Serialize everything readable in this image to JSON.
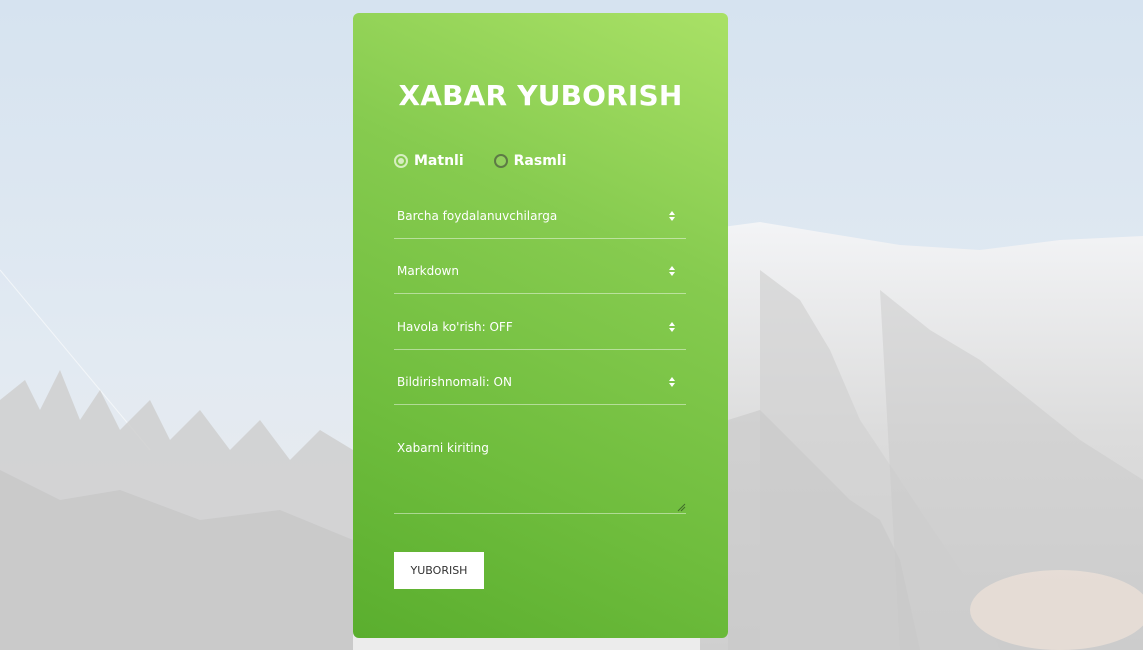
{
  "form": {
    "title": "XABAR YUBORISH",
    "message_type": {
      "options": [
        {
          "label": "Matnli",
          "checked": true
        },
        {
          "label": "Rasmli",
          "checked": false
        }
      ]
    },
    "selects": {
      "audience": "Barcha foydalanuvchilarga",
      "parse_mode": "Markdown",
      "link_preview": "Havola ko'rish: OFF",
      "notifications": "Bildirishnomali: ON"
    },
    "message": {
      "placeholder": "Xabarni kiriting",
      "value": ""
    },
    "submit_label": "YUBORISH"
  },
  "colors": {
    "card_top": "#a9e166",
    "card_bottom": "#5aae2e",
    "text": "#ffffff",
    "button_bg": "#ffffff",
    "button_text": "#333333"
  },
  "icons": {
    "select_arrow": "sort-updown-icon",
    "textarea_resize": "resize-handle-icon",
    "radio": "radio-icon"
  }
}
